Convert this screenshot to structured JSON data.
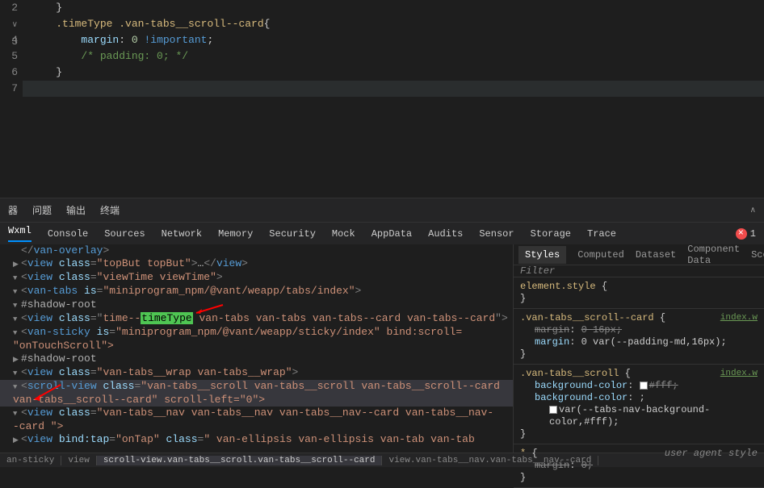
{
  "editor": {
    "line_numbers": [
      "2",
      "3",
      "4",
      "5",
      "6",
      "7"
    ],
    "lines": [
      {
        "indent": 1,
        "parts": [
          {
            "t": "}",
            "c": "tok-punct"
          }
        ]
      },
      {
        "indent": 1,
        "parts": [
          {
            "t": ".timeType .van-tabs__scroll--card",
            "c": "tok-selector"
          },
          {
            "t": "{",
            "c": "tok-punct"
          }
        ]
      },
      {
        "indent": 2,
        "parts": [
          {
            "t": "margin",
            "c": "tok-property"
          },
          {
            "t": ": ",
            "c": "tok-punct"
          },
          {
            "t": "0",
            "c": "tok-number"
          },
          {
            "t": " ",
            "c": "tok-punct"
          },
          {
            "t": "!important",
            "c": "tok-important"
          },
          {
            "t": ";",
            "c": "tok-punct"
          }
        ]
      },
      {
        "indent": 2,
        "parts": [
          {
            "t": "/* padding: 0; */",
            "c": "tok-comment"
          }
        ]
      },
      {
        "indent": 1,
        "parts": [
          {
            "t": "}",
            "c": "tok-punct"
          }
        ]
      },
      {
        "indent": 0,
        "current": true,
        "parts": []
      }
    ]
  },
  "panel": {
    "tabs": [
      "问题",
      "输出",
      "终端"
    ],
    "icon_prefix": "器"
  },
  "devtools": {
    "tabs": [
      "Wxml",
      "Console",
      "Sources",
      "Network",
      "Memory",
      "Security",
      "Mock",
      "AppData",
      "Audits",
      "Sensor",
      "Storage",
      "Trace"
    ],
    "error_count": "1"
  },
  "dom": {
    "lines": [
      {
        "i": 1,
        "twisty": "",
        "html": "</van-overlay>"
      },
      {
        "i": 1,
        "twisty": "▶",
        "html": "<view class=\"topBut topBut\">…</view>",
        "dots": true
      },
      {
        "i": 1,
        "twisty": "▼",
        "html": "<view class=\"viewTime viewTime\">"
      },
      {
        "i": 2,
        "twisty": "▼",
        "html": "<van-tabs is=\"miniprogram_npm/@vant/weapp/tabs/index\">"
      },
      {
        "i": 3,
        "twisty": "▼",
        "shadow": "#shadow-root"
      },
      {
        "i": 4,
        "twisty": "▼",
        "html_parts": [
          {
            "t": "<",
            "c": "tag-bracket"
          },
          {
            "t": "view",
            "c": "tag-name"
          },
          {
            "t": " ",
            "c": ""
          },
          {
            "t": "class",
            "c": "attr-name"
          },
          {
            "t": "=\"",
            "c": "tag-bracket"
          },
          {
            "t": "time--",
            "c": "attr-value"
          },
          {
            "t": "timeType",
            "c": "highlight-box"
          },
          {
            "t": " van-tabs van-tabs van-tabs--card van-tabs--card",
            "c": "attr-value"
          },
          {
            "t": "\">",
            "c": "tag-bracket"
          }
        ],
        "arrow": true
      },
      {
        "i": 5,
        "twisty": "▼",
        "html": "<van-sticky is=\"miniprogram_npm/@vant/weapp/sticky/index\" bind:scroll="
      },
      {
        "i": 5,
        "cont": true,
        "html": "\"onTouchScroll\">"
      },
      {
        "i": 6,
        "twisty": "▶",
        "shadow": "#shadow-root"
      },
      {
        "i": 6,
        "twisty": "▼",
        "html": "<view class=\"van-tabs__wrap van-tabs__wrap\">"
      },
      {
        "i": 7,
        "twisty": "▼",
        "html": "<scroll-view class=\"van-tabs__scroll van-tabs__scroll van-tabs__scroll--card",
        "highlighted": true
      },
      {
        "i": 7,
        "cont": true,
        "html": "van-tabs__scroll--card\" scroll-left=\"0\">",
        "highlighted": true,
        "arrow2": true
      },
      {
        "i": 8,
        "twisty": "▼",
        "html": "<view class=\"van-tabs__nav van-tabs__nav van-tabs__nav--card van-tabs__nav-"
      },
      {
        "i": 8,
        "cont": true,
        "html": "-card \">"
      },
      {
        "i": 9,
        "twisty": "▶",
        "html": "<view bind:tap=\"onTap\" class=\"  van-ellipsis van-ellipsis van-tab van-tab"
      }
    ]
  },
  "breadcrumb": {
    "items": [
      "an-sticky",
      "view",
      "scroll-view.van-tabs__scroll.van-tabs__scroll--card",
      "view.van-tabs__nav.van-tabs__nav--card"
    ]
  },
  "styles": {
    "tabs": [
      "Styles",
      "Computed",
      "Dataset",
      "Component Data",
      "Sco"
    ],
    "filter_placeholder": "Filter",
    "rules": [
      {
        "selector": "element.style",
        "props": []
      },
      {
        "selector": ".van-tabs__scroll--card",
        "link": "index.w",
        "props": [
          {
            "name": "margin",
            "value": "0 16px",
            "strike": true,
            "name_strike": true
          },
          {
            "name": "margin",
            "value": "0 var(--padding-md,16px)"
          }
        ]
      },
      {
        "selector": ".van-tabs__scroll",
        "link": "index.w",
        "props": [
          {
            "name": "background-color",
            "value": "#fff",
            "strike": true,
            "swatch": "#ffffff"
          },
          {
            "name": "background-color",
            "value": ""
          },
          {
            "name": "",
            "value": "var(--tabs-nav-background-color,#fff)",
            "swatch": "#ffffff",
            "indent": true
          }
        ]
      },
      {
        "selector": "*",
        "ua": "user agent style",
        "props": [
          {
            "name": "margin",
            "value": "0",
            "strike": true,
            "name_strike": true
          }
        ]
      }
    ]
  }
}
